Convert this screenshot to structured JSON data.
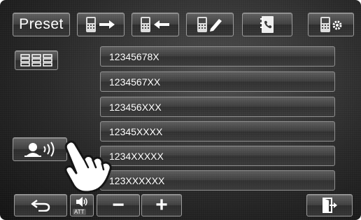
{
  "header": {
    "preset_label": "Preset",
    "buttons": [
      {
        "icon": "phone-to-car-transfer-icon"
      },
      {
        "icon": "car-to-phone-transfer-icon"
      },
      {
        "icon": "phone-delete-icon"
      },
      {
        "icon": "phonebook-icon"
      },
      {
        "icon": "phone-settings-icon"
      }
    ]
  },
  "left_panel": {
    "keypad_icon": "dial-keypad-icon",
    "voice_icon": "voice-dial-icon"
  },
  "number_list": [
    {
      "number": "12345678X"
    },
    {
      "number": "1234567XX"
    },
    {
      "number": "123456XXX"
    },
    {
      "number": "12345XXXX"
    },
    {
      "number": "1234XXXXX"
    },
    {
      "number": "123XXXXXX"
    }
  ],
  "footer": {
    "back_icon": "return-arrow-icon",
    "att_label": "ATT",
    "minus_label": "−",
    "plus_label": "+",
    "exit_icon": "exit-icon"
  }
}
